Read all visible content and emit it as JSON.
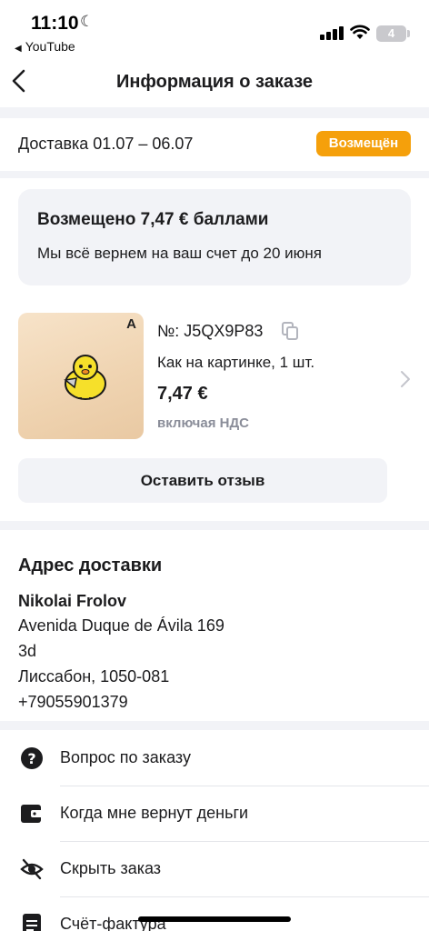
{
  "status_bar": {
    "time": "11:10",
    "back_app": "YouTube",
    "battery": "4"
  },
  "nav": {
    "title": "Информация о заказе"
  },
  "delivery": {
    "dates": "Доставка 01.07 – 06.07",
    "status_badge": "Возмещён",
    "badge_color": "#f5a00b"
  },
  "refund": {
    "title": "Возмещено 7,47 € баллами",
    "subtitle": "Мы всё вернем на ваш счет до 20 июня"
  },
  "product": {
    "image_letter": "A",
    "order_number": "№: J5QX9P83",
    "description": "Как на картинке, 1 шт.",
    "price": "7,47 €",
    "vat_note": "включая НДС",
    "review_button": "Оставить отзыв"
  },
  "address": {
    "title": "Адрес доставки",
    "name": "Nikolai Frolov",
    "lines": [
      "Avenida Duque de Ávila 169",
      "3d",
      "Лиссабон, 1050-081",
      "+79055901379"
    ]
  },
  "menu": [
    {
      "label": "Вопрос по заказу",
      "icon": "question-icon"
    },
    {
      "label": "Когда мне вернут деньги",
      "icon": "wallet-icon"
    },
    {
      "label": "Скрыть заказ",
      "icon": "eye-off-icon"
    },
    {
      "label": "Счёт-фактура",
      "icon": "document-icon"
    }
  ]
}
